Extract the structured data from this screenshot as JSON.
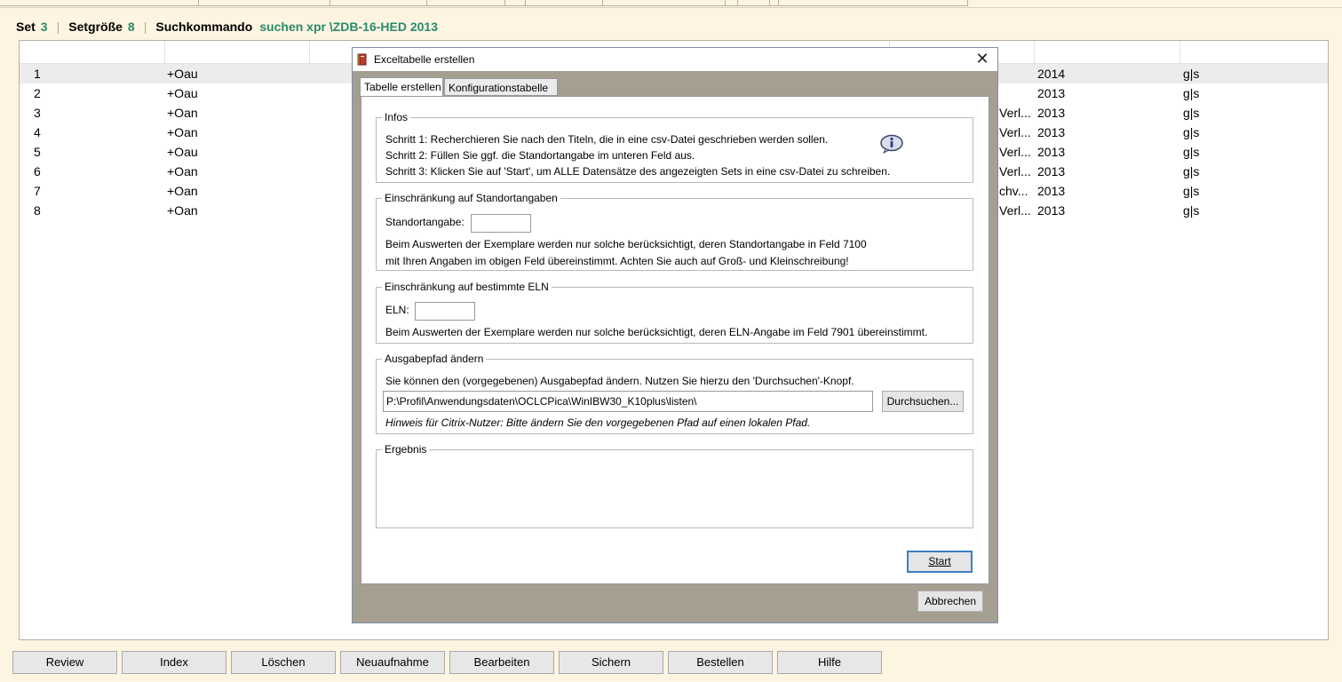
{
  "header": {
    "set_label": "Set",
    "set_value": "3",
    "size_label": "Setgröße",
    "size_value": "8",
    "command_label": "Suchkommando",
    "command_value": "suchen xpr \\ZDB-16-HED 2013"
  },
  "results": [
    {
      "num": "1",
      "code": "+Oau",
      "pub": "",
      "year": "2014",
      "flag": "g|s"
    },
    {
      "num": "2",
      "code": "+Oau",
      "pub": "",
      "year": "2013",
      "flag": "g|s"
    },
    {
      "num": "3",
      "code": "+Oan",
      "pub": "Verl...",
      "year": "2013",
      "flag": "g|s"
    },
    {
      "num": "4",
      "code": "+Oan",
      "pub": "Verl...",
      "year": "2013",
      "flag": "g|s"
    },
    {
      "num": "5",
      "code": "+Oau",
      "pub": "Verl...",
      "year": "2013",
      "flag": "g|s"
    },
    {
      "num": "6",
      "code": "+Oan",
      "pub": "Verl...",
      "year": "2013",
      "flag": "g|s"
    },
    {
      "num": "7",
      "code": "+Oan",
      "pub": "chv...",
      "year": "2013",
      "flag": "g|s"
    },
    {
      "num": "8",
      "code": "+Oan",
      "pub": "Verl...",
      "year": "2013",
      "flag": "g|s"
    }
  ],
  "bottom_buttons": [
    "Review",
    "Index",
    "Löschen",
    "Neuaufnahme",
    "Bearbeiten",
    "Sichern",
    "Bestellen",
    "Hilfe"
  ],
  "dialog": {
    "title": "Exceltabelle erstellen",
    "close_glyph": "✕",
    "tabs": [
      "Tabelle erstellen",
      "Konfigurationstabelle"
    ],
    "infos": {
      "legend": "Infos",
      "step1": "Schritt 1: Recherchieren Sie nach den Titeln, die in eine csv-Datei geschrieben werden sollen.",
      "step2": "Schritt 2: Füllen Sie ggf. die Standortangabe im unteren Feld aus.",
      "step3": "Schritt 3: Klicken Sie auf 'Start', um ALLE Datensätze des angezeigten Sets in eine csv-Datei zu schreiben."
    },
    "standort": {
      "legend": "Einschränkung auf Standortangaben",
      "label": "Standortangabe:",
      "value": "",
      "text1": "Beim Auswerten der Exemplare werden nur solche berücksichtigt, deren Standortangabe in Feld 7100",
      "text2": "mit Ihren Angaben im obigen Feld übereinstimmt. Achten Sie auch auf Groß- und Kleinschreibung!"
    },
    "eln": {
      "legend": "Einschränkung auf bestimmte ELN",
      "label": "ELN:",
      "value": "",
      "text1": "Beim Auswerten der Exemplare werden nur solche berücksichtigt, deren ELN-Angabe im Feld 7901 übereinstimmt."
    },
    "ausgabe": {
      "legend": "Ausgabepfad ändern",
      "text1": "Sie können den (vorgegebenen) Ausgabepfad ändern. Nutzen Sie hierzu den 'Durchsuchen'-Knopf.",
      "path": "P:\\Profil\\Anwendungsdaten\\OCLCPica\\WinIBW30_K10plus\\listen\\",
      "browse": "Durchsuchen...",
      "hint": "Hinweis für Citrix-Nutzer: Bitte ändern Sie den vorgegebenen Pfad auf einen lokalen Pfad."
    },
    "ergebnis": {
      "legend": "Ergebnis",
      "text": ""
    },
    "start": "Start",
    "cancel": "Abbrechen"
  },
  "colors": {
    "accent_green": "#2a8a6b",
    "background": "#fdf5e2",
    "dialog_frame": "#a59f92"
  }
}
